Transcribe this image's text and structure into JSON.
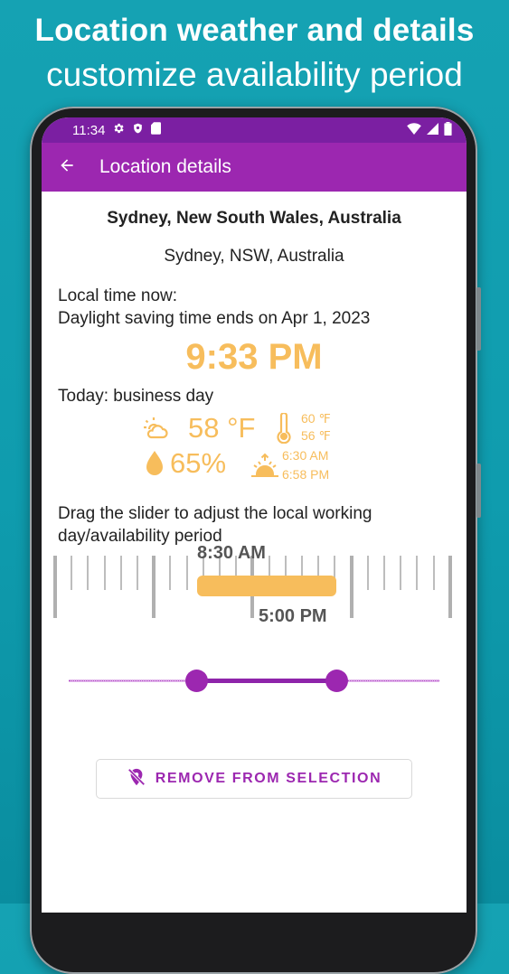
{
  "promo": {
    "line1": "Location weather and details",
    "line2": "customize availability period"
  },
  "status_bar": {
    "time": "11:34",
    "icons": [
      "gear-icon",
      "shield-icon",
      "sd-card-icon",
      "wifi-icon",
      "signal-icon",
      "battery-icon"
    ]
  },
  "app_bar": {
    "title": "Location details",
    "back_icon": "arrow-left-icon"
  },
  "location": {
    "full_name": "Sydney, New South Wales, Australia",
    "short_name": "Sydney, NSW, Australia"
  },
  "local_time": {
    "label": "Local time now:",
    "dst_note": "Daylight saving time ends on Apr 1, 2023",
    "time": "9:33 PM"
  },
  "today": {
    "label": "Today: business day"
  },
  "weather": {
    "temperature": "58 °F",
    "high": "60 ℉",
    "low": "56 ℉",
    "humidity": "65%",
    "sunrise": "6:30 AM",
    "sunset": "6:58 PM",
    "icons": [
      "partly-cloudy-icon",
      "thermometer-icon",
      "humidity-drop-icon",
      "sunrise-sunset-icon"
    ]
  },
  "availability": {
    "instruction": "Drag the slider to adjust the local working day/availability period",
    "start": "8:30 AM",
    "end": "5:00 PM"
  },
  "actions": {
    "remove_label": "REMOVE FROM SELECTION"
  },
  "colors": {
    "status_bar": "#7b1fa2",
    "app_bar": "#9c27b0",
    "accent": "#f7bd5c",
    "background": "#15a2b3"
  }
}
